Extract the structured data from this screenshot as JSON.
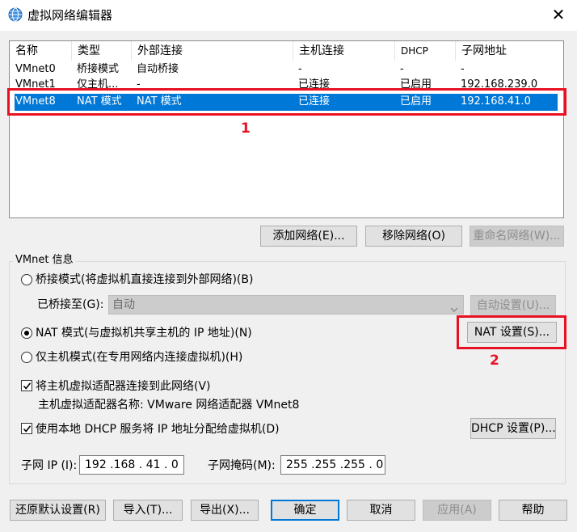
{
  "window": {
    "title": "虚拟网络编辑器",
    "close_glyph": "✕"
  },
  "table": {
    "headers": [
      "名称",
      "类型",
      "外部连接",
      "主机连接",
      "DHCP",
      "子网地址"
    ],
    "rows": [
      [
        "VMnet0",
        "桥接模式",
        "自动桥接",
        "-",
        "-",
        "-"
      ],
      [
        "VMnet1",
        "仅主机...",
        "-",
        "已连接",
        "已启用",
        "192.168.239.0"
      ],
      [
        "VMnet8",
        "NAT 模式",
        "NAT 模式",
        "已连接",
        "已启用",
        "192.168.41.0"
      ]
    ],
    "selected_row": 2
  },
  "table_buttons": {
    "add": "添加网络(E)...",
    "remove": "移除网络(O)",
    "rename": "重命名网络(W)..."
  },
  "vmnet_info": {
    "group_label": "VMnet 信息",
    "bridged_label": "桥接模式(将虚拟机直接连接到外部网络)(B)",
    "bridged_to_label": "已桥接至(G):",
    "bridged_to_value": "自动",
    "auto_settings": "自动设置(U)...",
    "nat_label": "NAT 模式(与虚拟机共享主机的 IP 地址)(N)",
    "nat_settings": "NAT 设置(S)...",
    "hostonly_label": "仅主机模式(在专用网络内连接虚拟机)(H)",
    "selected_mode": "nat",
    "connect_adapter_label": "将主机虚拟适配器连接到此网络(V)",
    "connect_adapter_checked": true,
    "adapter_name_label": "主机虚拟适配器名称: VMware 网络适配器 VMnet8",
    "dhcp_label": "使用本地 DHCP 服务将 IP 地址分配给虚拟机(D)",
    "dhcp_checked": true,
    "dhcp_settings": "DHCP 设置(P)...",
    "subnet_ip_label": "子网 IP (I):",
    "subnet_ip_value": "192 .168 . 41 . 0",
    "subnet_mask_label": "子网掩码(M):",
    "subnet_mask_value": "255 .255 .255 . 0"
  },
  "bottom_buttons": {
    "restore": "还原默认设置(R)",
    "import": "导入(T)...",
    "export": "导出(X)...",
    "ok": "确定",
    "cancel": "取消",
    "apply": "应用(A)",
    "help": "帮助"
  },
  "annotations": {
    "label_1": "1",
    "label_2": "2",
    "color": "#e81123"
  },
  "colors": {
    "selection": "#0078d7",
    "window_bg": "#f0f0f0"
  },
  "icons": {
    "title": "globe-network-icon",
    "dropdown": "chevron-down-icon"
  }
}
